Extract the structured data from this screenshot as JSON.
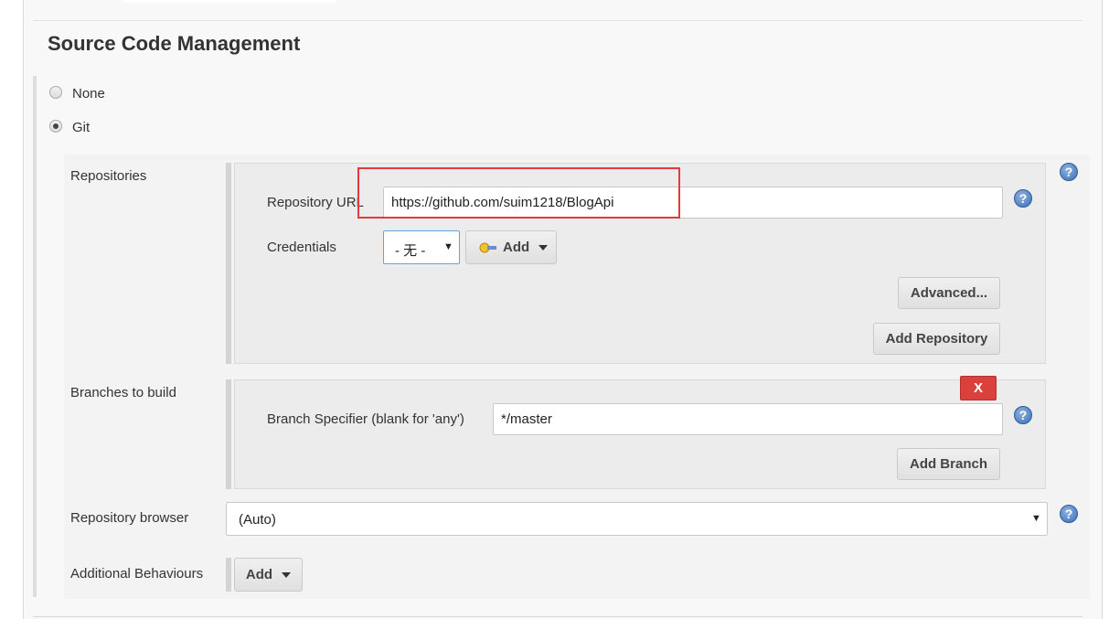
{
  "section": {
    "title": "Source Code Management"
  },
  "scm_options": [
    {
      "label": "None",
      "checked": false
    },
    {
      "label": "Git",
      "checked": true
    }
  ],
  "repositories": {
    "label": "Repositories",
    "url_label": "Repository URL",
    "url_value": "https://github.com/suim1218/BlogApi",
    "credentials_label": "Credentials",
    "credentials_value": "- 无 -",
    "add_label": "Add",
    "advanced_label": "Advanced...",
    "add_repository_label": "Add Repository"
  },
  "branches": {
    "label": "Branches to build",
    "delete_label": "X",
    "specifier_label": "Branch Specifier (blank for 'any')",
    "specifier_value": "*/master",
    "add_branch_label": "Add Branch"
  },
  "repository_browser": {
    "label": "Repository browser",
    "value": "(Auto)"
  },
  "additional_behaviours": {
    "label": "Additional Behaviours",
    "add_label": "Add"
  },
  "colors": {
    "highlight": "#e33b3b",
    "delete": "#d9413a",
    "help": "#3c6fb4"
  }
}
